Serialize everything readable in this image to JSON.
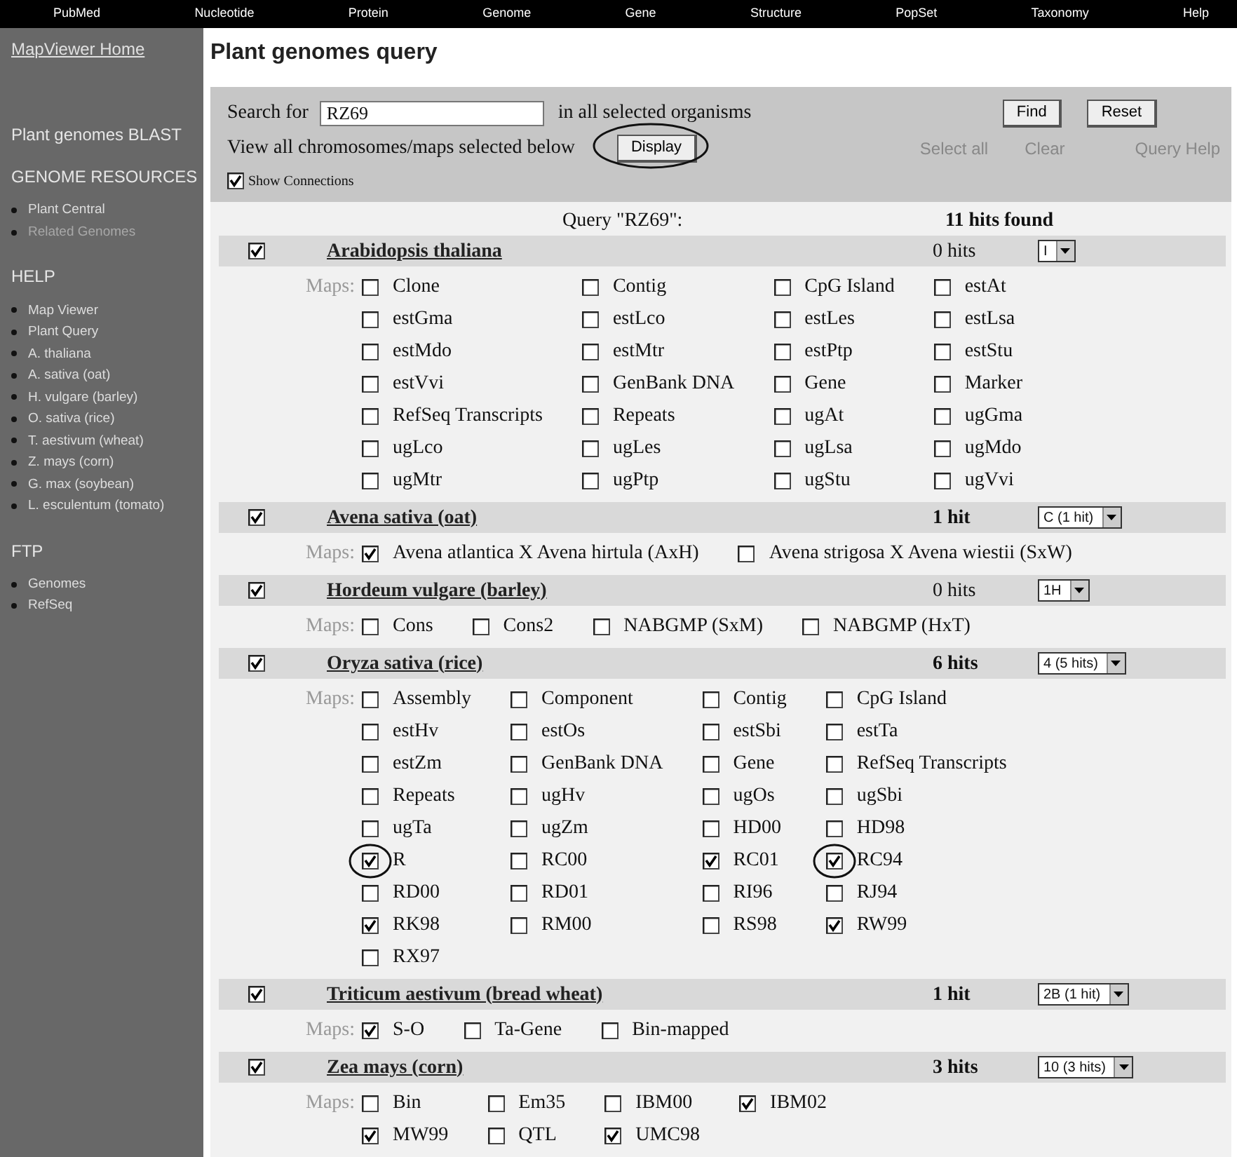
{
  "nav": [
    "PubMed",
    "Nucleotide",
    "Protein",
    "Genome",
    "Gene",
    "Structure",
    "PopSet",
    "Taxonomy",
    "Help"
  ],
  "sidebar": {
    "home": "MapViewer Home",
    "sections": [
      {
        "title": "Plant genomes BLAST"
      },
      {
        "title": "GENOME RESOURCES",
        "items": [
          {
            "label": "Plant Central",
            "disabled": false
          },
          {
            "label": "Related Genomes",
            "disabled": true
          }
        ]
      },
      {
        "title": "HELP",
        "items": [
          {
            "label": "Map Viewer",
            "disabled": false
          },
          {
            "label": "Plant Query",
            "disabled": false
          },
          {
            "label": "A. thaliana",
            "disabled": false
          },
          {
            "label": "A. sativa (oat)",
            "disabled": false
          },
          {
            "label": "H. vulgare (barley)",
            "disabled": false
          },
          {
            "label": "O. sativa (rice)",
            "disabled": false
          },
          {
            "label": "T. aestivum (wheat)",
            "disabled": false
          },
          {
            "label": "Z. mays (corn)",
            "disabled": false
          },
          {
            "label": "G. max (soybean)",
            "disabled": false
          },
          {
            "label": "L. esculentum (tomato)",
            "disabled": false
          }
        ]
      },
      {
        "title": "FTP",
        "items": [
          {
            "label": "Genomes",
            "disabled": false
          },
          {
            "label": "RefSeq",
            "disabled": false
          }
        ]
      }
    ]
  },
  "title": "Plant genomes query",
  "search": {
    "label": "Search for",
    "value": "RZ69",
    "suffix": "in all selected organisms",
    "buttons": [
      "Find",
      "Reset"
    ],
    "view_label": "View all chromosomes/maps selected below",
    "display_button": {
      "label": "Display",
      "circled": true
    },
    "links": [
      "Select all",
      "Clear",
      "Query Help"
    ],
    "show_connections": {
      "label": "Show Connections",
      "checked": true
    }
  },
  "summary": {
    "query": "Query \"RZ69\":",
    "hits": "11 hits found"
  },
  "organisms": [
    {
      "name": "Arabidopsis thaliana",
      "checked": true,
      "hits": "0 hits",
      "has_hits": false,
      "chromosome": "I",
      "maps_label": "Maps:",
      "maps": [
        {
          "label": "Clone",
          "checked": false,
          "circled": false
        },
        {
          "label": "Contig",
          "checked": false,
          "circled": false
        },
        {
          "label": "CpG Island",
          "checked": false,
          "circled": false
        },
        {
          "label": "estAt",
          "checked": false,
          "circled": false
        },
        {
          "label": "estGma",
          "checked": false,
          "circled": false
        },
        {
          "label": "estLco",
          "checked": false,
          "circled": false
        },
        {
          "label": "estLes",
          "checked": false,
          "circled": false
        },
        {
          "label": "estLsa",
          "checked": false,
          "circled": false
        },
        {
          "label": "estMdo",
          "checked": false,
          "circled": false
        },
        {
          "label": "estMtr",
          "checked": false,
          "circled": false
        },
        {
          "label": "estPtp",
          "checked": false,
          "circled": false
        },
        {
          "label": "estStu",
          "checked": false,
          "circled": false
        },
        {
          "label": "estVvi",
          "checked": false,
          "circled": false
        },
        {
          "label": "GenBank DNA",
          "checked": false,
          "circled": false
        },
        {
          "label": "Gene",
          "checked": false,
          "circled": false
        },
        {
          "label": "Marker",
          "checked": false,
          "circled": false
        },
        {
          "label": "RefSeq Transcripts",
          "checked": false,
          "circled": false
        },
        {
          "label": "Repeats",
          "checked": false,
          "circled": false
        },
        {
          "label": "ugAt",
          "checked": false,
          "circled": false
        },
        {
          "label": "ugGma",
          "checked": false,
          "circled": false
        },
        {
          "label": "ugLco",
          "checked": false,
          "circled": false
        },
        {
          "label": "ugLes",
          "checked": false,
          "circled": false
        },
        {
          "label": "ugLsa",
          "checked": false,
          "circled": false
        },
        {
          "label": "ugMdo",
          "checked": false,
          "circled": false
        },
        {
          "label": "ugMtr",
          "checked": false,
          "circled": false
        },
        {
          "label": "ugPtp",
          "checked": false,
          "circled": false
        },
        {
          "label": "ugStu",
          "checked": false,
          "circled": false
        },
        {
          "label": "ugVvi",
          "checked": false,
          "circled": false
        }
      ]
    },
    {
      "name": "Avena sativa (oat)",
      "checked": true,
      "hits": "1 hit",
      "has_hits": true,
      "chromosome": "C (1 hit)",
      "maps_label": "Maps:",
      "maps": [
        {
          "label": "Avena atlantica X Avena hirtula (AxH)",
          "checked": true,
          "circled": false
        },
        {
          "label": "Avena strigosa X Avena wiestii (SxW)",
          "checked": false,
          "circled": false
        }
      ]
    },
    {
      "name": "Hordeum vulgare (barley)",
      "checked": true,
      "hits": "0 hits",
      "has_hits": false,
      "chromosome": "1H",
      "maps_label": "Maps:",
      "maps": [
        {
          "label": "Cons",
          "checked": false,
          "circled": false
        },
        {
          "label": "Cons2",
          "checked": false,
          "circled": false
        },
        {
          "label": "NABGMP (SxM)",
          "checked": false,
          "circled": false
        },
        {
          "label": "NABGMP (HxT)",
          "checked": false,
          "circled": false
        }
      ]
    },
    {
      "name": "Oryza sativa (rice)",
      "checked": true,
      "hits": "6 hits",
      "has_hits": true,
      "chromosome": "4 (5 hits)",
      "maps_label": "Maps:",
      "maps": [
        {
          "label": "Assembly",
          "checked": false,
          "circled": false
        },
        {
          "label": "Component",
          "checked": false,
          "circled": false
        },
        {
          "label": "Contig",
          "checked": false,
          "circled": false
        },
        {
          "label": "CpG Island",
          "checked": false,
          "circled": false
        },
        {
          "label": "estHv",
          "checked": false,
          "circled": false
        },
        {
          "label": "estOs",
          "checked": false,
          "circled": false
        },
        {
          "label": "estSbi",
          "checked": false,
          "circled": false
        },
        {
          "label": "estTa",
          "checked": false,
          "circled": false
        },
        {
          "label": "estZm",
          "checked": false,
          "circled": false
        },
        {
          "label": "GenBank DNA",
          "checked": false,
          "circled": false
        },
        {
          "label": "Gene",
          "checked": false,
          "circled": false
        },
        {
          "label": "RefSeq Transcripts",
          "checked": false,
          "circled": false
        },
        {
          "label": "Repeats",
          "checked": false,
          "circled": false
        },
        {
          "label": "ugHv",
          "checked": false,
          "circled": false
        },
        {
          "label": "ugOs",
          "checked": false,
          "circled": false
        },
        {
          "label": "ugSbi",
          "checked": false,
          "circled": false
        },
        {
          "label": "ugTa",
          "checked": false,
          "circled": false
        },
        {
          "label": "ugZm",
          "checked": false,
          "circled": false
        },
        {
          "label": "HD00",
          "checked": false,
          "circled": false
        },
        {
          "label": "HD98",
          "checked": false,
          "circled": false
        },
        {
          "label": "R",
          "checked": true,
          "circled": true
        },
        {
          "label": "RC00",
          "checked": false,
          "circled": false
        },
        {
          "label": "RC01",
          "checked": true,
          "circled": false
        },
        {
          "label": "RC94",
          "checked": true,
          "circled": true
        },
        {
          "label": "RD00",
          "checked": false,
          "circled": false
        },
        {
          "label": "RD01",
          "checked": false,
          "circled": false
        },
        {
          "label": "RI96",
          "checked": false,
          "circled": false
        },
        {
          "label": "RJ94",
          "checked": false,
          "circled": false
        },
        {
          "label": "RK98",
          "checked": true,
          "circled": false
        },
        {
          "label": "RM00",
          "checked": false,
          "circled": false
        },
        {
          "label": "RS98",
          "checked": false,
          "circled": false
        },
        {
          "label": "RW99",
          "checked": true,
          "circled": false
        },
        {
          "label": "RX97",
          "checked": false,
          "circled": false
        }
      ]
    },
    {
      "name": "Triticum aestivum (bread wheat)",
      "checked": true,
      "hits": "1 hit",
      "has_hits": true,
      "chromosome": "2B (1 hit)",
      "maps_label": "Maps:",
      "maps": [
        {
          "label": "S-O",
          "checked": true,
          "circled": false
        },
        {
          "label": "Ta-Gene",
          "checked": false,
          "circled": false
        },
        {
          "label": "Bin-mapped",
          "checked": false,
          "circled": false
        }
      ]
    },
    {
      "name": "Zea mays (corn)",
      "checked": true,
      "hits": "3 hits",
      "has_hits": true,
      "chromosome": "10 (3 hits)",
      "maps_label": "Maps:",
      "maps": [
        {
          "label": "Bin",
          "checked": false,
          "circled": false
        },
        {
          "label": "Em35",
          "checked": false,
          "circled": false
        },
        {
          "label": "IBM00",
          "checked": false,
          "circled": false
        },
        {
          "label": "IBM02",
          "checked": true,
          "circled": false
        },
        {
          "label": "MW99",
          "checked": true,
          "circled": false
        },
        {
          "label": "QTL",
          "checked": false,
          "circled": false
        },
        {
          "label": "UMC98",
          "checked": true,
          "circled": false
        }
      ]
    }
  ]
}
